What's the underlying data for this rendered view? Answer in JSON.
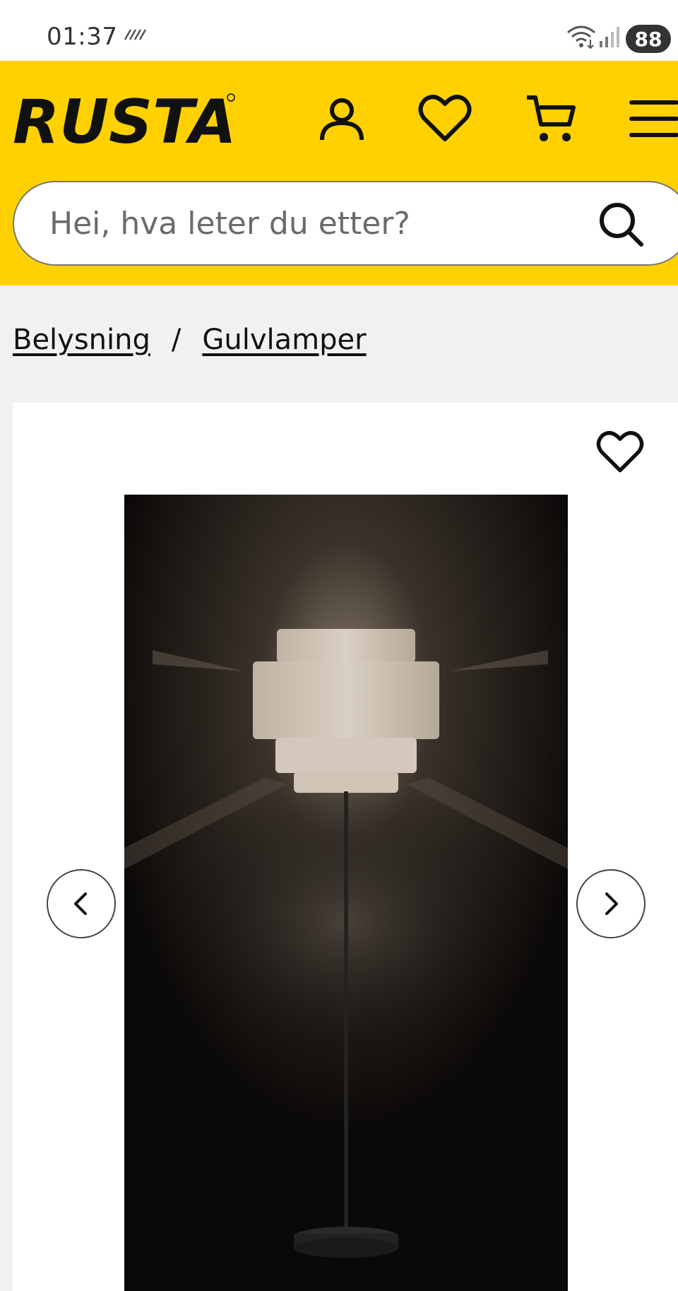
{
  "status_bar": {
    "time": "01:37",
    "battery": "88",
    "icons": [
      "data-saver-icon",
      "wifi-icon",
      "signal-icon",
      "battery-icon"
    ]
  },
  "header": {
    "logo_text": "RUSTA",
    "brand_color": "#ffd100",
    "icons": [
      "user-icon",
      "heart-icon",
      "cart-icon",
      "menu-icon"
    ],
    "search": {
      "placeholder": "Hei, hva leter du etter?",
      "value": ""
    }
  },
  "breadcrumb": {
    "items": [
      {
        "label": "Belysning"
      },
      {
        "label": "Gulvlamper"
      }
    ],
    "separator": "/"
  },
  "product": {
    "image": "floor-lamp-photo",
    "carousel_icons": [
      "chevron-left-icon",
      "chevron-right-icon"
    ],
    "favorite_icon": "heart-outline-icon"
  }
}
